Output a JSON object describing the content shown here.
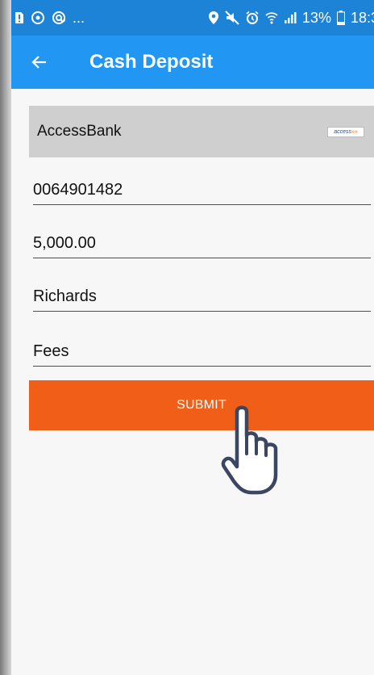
{
  "status_bar": {
    "left_icons": [
      "sim-alert-icon",
      "sync-icon",
      "at-icon"
    ],
    "left_more": "...",
    "battery": "13%",
    "time": "18:3"
  },
  "app_bar": {
    "title": "Cash Deposit",
    "color": "#2196f3"
  },
  "form": {
    "bank": {
      "name": "AccessBank",
      "logo_text": "access",
      "logo_arrows": "»»"
    },
    "account_number": "0064901482",
    "amount": "5,000.00",
    "depositor_name": "Richards",
    "narration": "Fees",
    "submit_label": "SUBMIT",
    "submit_color": "#f15e17"
  }
}
